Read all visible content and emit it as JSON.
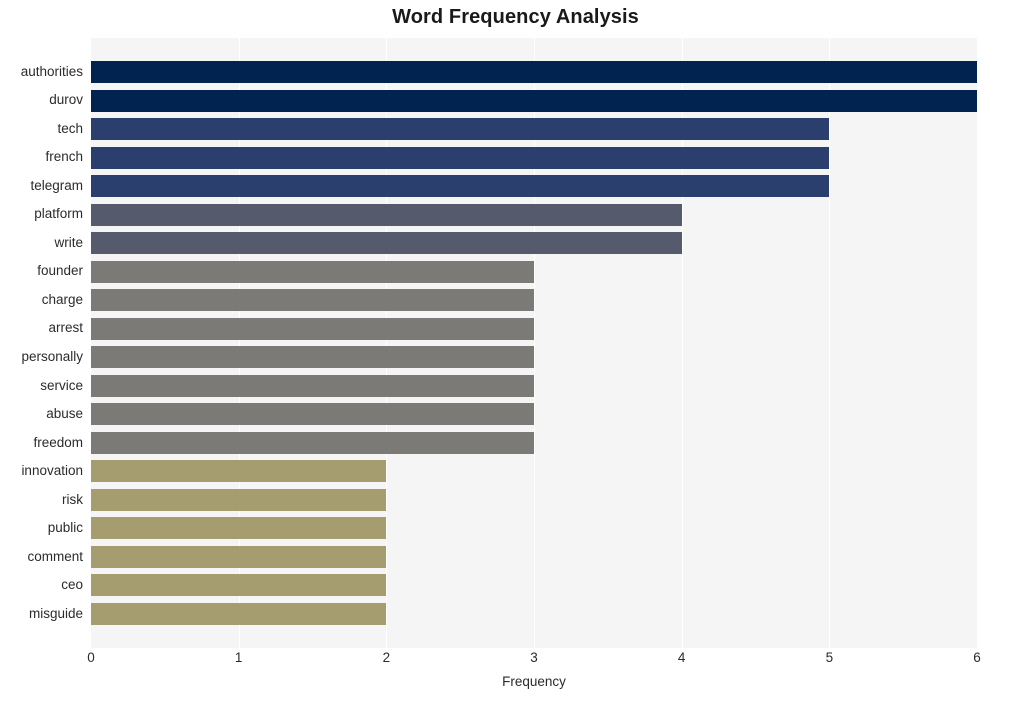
{
  "chart_data": {
    "type": "bar",
    "orientation": "horizontal",
    "title": "Word Frequency Analysis",
    "xlabel": "Frequency",
    "ylabel": "",
    "xlim": [
      0,
      6
    ],
    "xticks": [
      0,
      1,
      2,
      3,
      4,
      5,
      6
    ],
    "xtick_labels": [
      "0",
      "1",
      "2",
      "3",
      "4",
      "5",
      "6"
    ],
    "grid": true,
    "legend": null,
    "categories": [
      "authorities",
      "durov",
      "tech",
      "french",
      "telegram",
      "platform",
      "write",
      "founder",
      "charge",
      "arrest",
      "personally",
      "service",
      "abuse",
      "freedom",
      "innovation",
      "risk",
      "public",
      "comment",
      "ceo",
      "misguide"
    ],
    "values": [
      6,
      6,
      5,
      5,
      5,
      4,
      4,
      3,
      3,
      3,
      3,
      3,
      3,
      3,
      2,
      2,
      2,
      2,
      2,
      2
    ],
    "bar_colors": [
      "#002350",
      "#002350",
      "#2b3f6e",
      "#2b3f6e",
      "#2b3f6e",
      "#555a6d",
      "#555a6d",
      "#7b7a77",
      "#7b7a77",
      "#7b7a77",
      "#7b7a77",
      "#7b7a77",
      "#7b7a77",
      "#7b7a77",
      "#a59c70",
      "#a59c70",
      "#a59c70",
      "#a59c70",
      "#a59c70",
      "#a59c70"
    ],
    "plot_background": "#f5f5f6",
    "figure_background": "#ffffff",
    "gridline_color": "#ffffff",
    "text_color": "#2b2b2b",
    "title_color": "#1a1a1a"
  }
}
